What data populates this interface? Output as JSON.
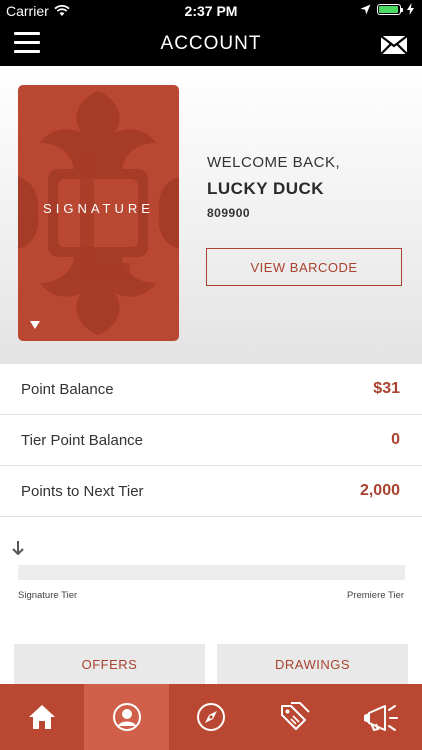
{
  "status_bar": {
    "carrier": "Carrier",
    "time": "2:37 PM"
  },
  "nav": {
    "title": "ACCOUNT",
    "menu_icon": "hamburger-menu-icon",
    "mail_icon": "envelope-icon"
  },
  "card": {
    "label": "SIGNATURE",
    "color": "#b94731"
  },
  "member": {
    "greeting": "WELCOME BACK,",
    "name": "LUCKY DUCK",
    "number": "809900",
    "barcode_button": "VIEW BARCODE"
  },
  "balances": [
    {
      "label": "Point Balance",
      "value": "$31"
    },
    {
      "label": "Tier Point Balance",
      "value": "0"
    },
    {
      "label": "Points to Next Tier",
      "value": "2,000"
    }
  ],
  "tier": {
    "current": "Signature Tier",
    "next": "Premiere Tier",
    "progress": 0
  },
  "actions": {
    "offers": "OFFERS",
    "drawings": "DRAWINGS"
  },
  "tabs": [
    {
      "icon": "home-icon",
      "active": false
    },
    {
      "icon": "account-icon",
      "active": true
    },
    {
      "icon": "compass-icon",
      "active": false
    },
    {
      "icon": "offers-tag-icon",
      "active": false
    },
    {
      "icon": "megaphone-icon",
      "active": false
    }
  ],
  "colors": {
    "accent": "#a9432f",
    "tab_bar": "#b94731",
    "tab_active": "#d0604a"
  }
}
